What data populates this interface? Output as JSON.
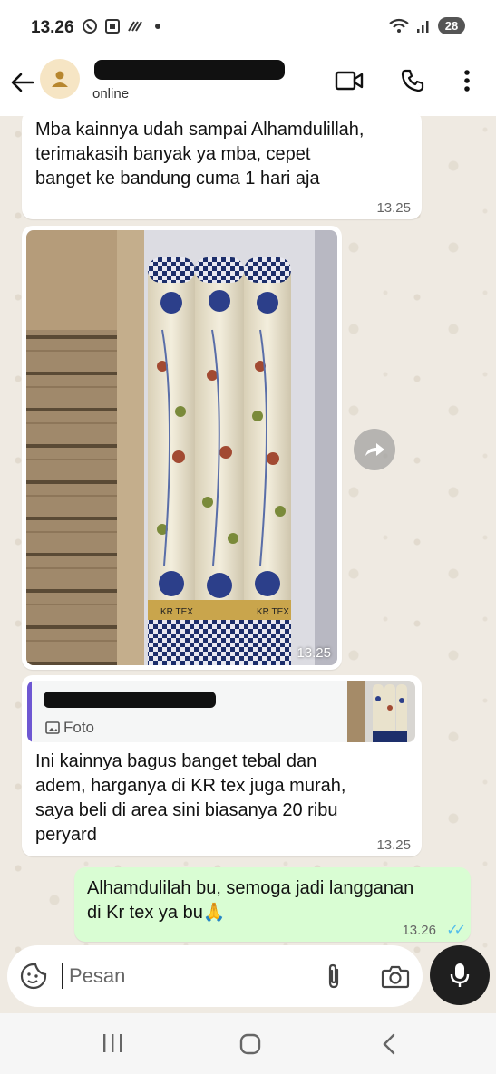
{
  "status_bar": {
    "time": "13.26",
    "battery": "28"
  },
  "header": {
    "contact_status": "online"
  },
  "messages": [
    {
      "id": "msg1",
      "direction": "incoming",
      "text_lines": [
        "Mba kainnya udah sampai Alhamdulillah,",
        "terimakasih banyak ya mba, cepet",
        "banget ke bandung cuma 1 hari aja"
      ],
      "time": "13.25"
    },
    {
      "id": "msg2",
      "direction": "incoming",
      "type": "photo",
      "roll_label": "KR TEX",
      "time": "13.25"
    },
    {
      "id": "msg3",
      "direction": "incoming",
      "quote_label": "Foto",
      "text_lines": [
        "Ini kainnya bagus banget tebal dan",
        "adem, harganya di KR tex juga murah,",
        "saya beli di area sini biasanya 20 ribu",
        "peryard"
      ],
      "time": "13.25"
    },
    {
      "id": "msg4",
      "direction": "outgoing",
      "text_lines": [
        "Alhamdulilah bu, semoga jadi langganan",
        "di Kr tex ya bu"
      ],
      "emoji": "🙏",
      "time": "13.26",
      "ticks": "✓✓"
    }
  ],
  "composer": {
    "placeholder": "Pesan"
  },
  "colors": {
    "chat_bg": "#efeae2",
    "outgoing_bubble": "#d9fdd3",
    "read_ticks": "#53bdeb",
    "quote_accent": "#6e57d2"
  }
}
